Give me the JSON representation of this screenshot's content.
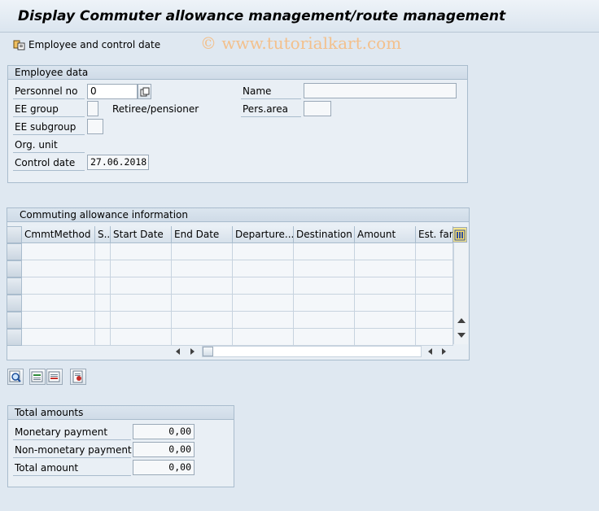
{
  "window": {
    "title": "Display Commuter allowance management/route management"
  },
  "toolbar": {
    "employee_button": "Employee and control date",
    "watermark": "© www.tutorialkart.com"
  },
  "employee_data": {
    "title": "Employee data",
    "personnel_no_label": "Personnel no",
    "personnel_no_value": "0",
    "ee_group_label": "EE group",
    "retiree_label": "Retiree/pensioner",
    "ee_subgroup_label": "EE subgroup",
    "org_unit_label": "Org. unit",
    "control_date_label": "Control date",
    "control_date_value": "27.06.2018",
    "name_label": "Name",
    "pers_area_label": "Pers.area"
  },
  "commuting": {
    "title": "Commuting allowance information",
    "columns": [
      "CmmtMethod",
      "S..",
      "Start Date",
      "End Date",
      "Departure...",
      "Destination",
      "Amount",
      "Est. fare"
    ]
  },
  "totals": {
    "title": "Total amounts",
    "monetary_label": "Monetary payment",
    "monetary_value": "0,00",
    "non_monetary_label": "Non-monetary payment",
    "non_monetary_value": "0,00",
    "total_label": "Total amount",
    "total_value": "0,00"
  }
}
